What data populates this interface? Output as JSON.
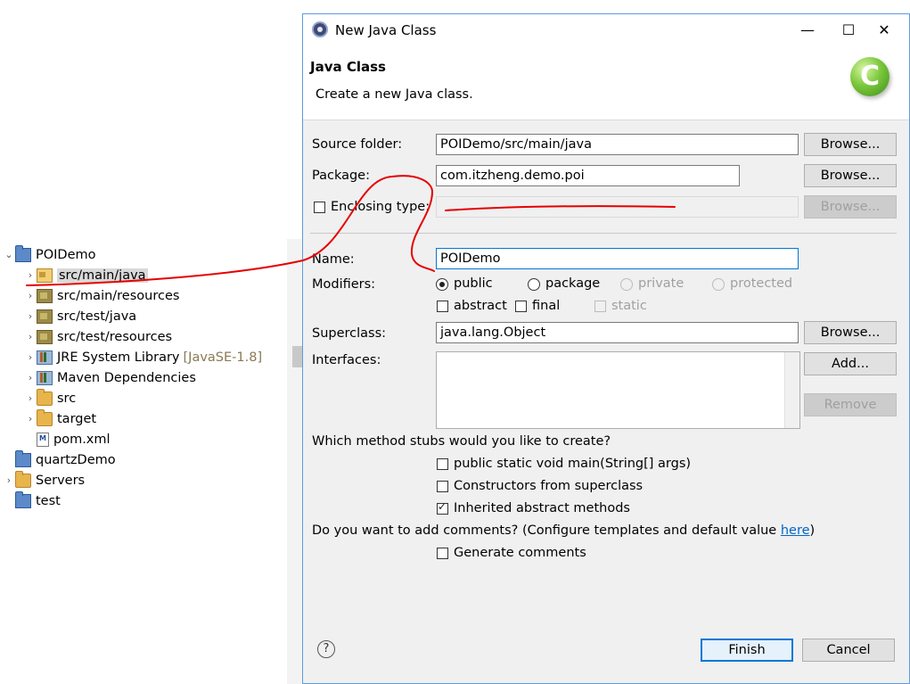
{
  "explorer": {
    "items": [
      {
        "label": "POIDemo",
        "decoration": "",
        "icon": "project-icon",
        "chevron": "v",
        "indent": 0
      },
      {
        "label": "src/main/java",
        "decoration": "",
        "icon": "source-folder-icon",
        "chevron": ">",
        "indent": 1,
        "selected": true
      },
      {
        "label": "src/main/resources",
        "decoration": "",
        "icon": "package-folder-icon",
        "chevron": ">",
        "indent": 1
      },
      {
        "label": "src/test/java",
        "decoration": "",
        "icon": "package-folder-icon",
        "chevron": ">",
        "indent": 1
      },
      {
        "label": "src/test/resources",
        "decoration": "",
        "icon": "package-folder-icon",
        "chevron": ">",
        "indent": 1
      },
      {
        "label": "JRE System Library",
        "decoration": "[JavaSE-1.8]",
        "icon": "library-icon",
        "chevron": ">",
        "indent": 1
      },
      {
        "label": "Maven Dependencies",
        "decoration": "",
        "icon": "library-icon",
        "chevron": ">",
        "indent": 1
      },
      {
        "label": "src",
        "decoration": "",
        "icon": "folder-icon",
        "chevron": ">",
        "indent": 1
      },
      {
        "label": "target",
        "decoration": "",
        "icon": "folder-icon",
        "chevron": ">",
        "indent": 1
      },
      {
        "label": "pom.xml",
        "decoration": "",
        "icon": "pom-file-icon",
        "chevron": "",
        "indent": 1
      },
      {
        "label": "quartzDemo",
        "decoration": "",
        "icon": "project-icon",
        "chevron": "",
        "indent": 0
      },
      {
        "label": "Servers",
        "decoration": "",
        "icon": "folder-icon",
        "chevron": ">",
        "indent": 0
      },
      {
        "label": "test",
        "decoration": "",
        "icon": "project-icon",
        "chevron": "",
        "indent": 0
      }
    ]
  },
  "dialog": {
    "title": "New Java Class",
    "controls": {
      "minimize": "—",
      "maximize": "☐",
      "close": "✕"
    },
    "banner": {
      "title": "Java Class",
      "description": "Create a new Java class.",
      "icon_letter": "C"
    },
    "source_folder": {
      "label": "Source folder:",
      "value": "POIDemo/src/main/java",
      "browse": "Browse..."
    },
    "package": {
      "label": "Package:",
      "value": "com.itzheng.demo.poi",
      "browse": "Browse..."
    },
    "enclosing": {
      "label": "Enclosing type:",
      "value": "",
      "browse": "Browse...",
      "checked": false
    },
    "name": {
      "label": "Name:",
      "value": "POIDemo"
    },
    "modifiers": {
      "label": "Modifiers:",
      "radios": [
        {
          "label": "public",
          "selected": true,
          "enabled": true
        },
        {
          "label": "package",
          "selected": false,
          "enabled": true
        },
        {
          "label": "private",
          "selected": false,
          "enabled": false
        },
        {
          "label": "protected",
          "selected": false,
          "enabled": false
        }
      ],
      "checks": [
        {
          "label": "abstract",
          "checked": false,
          "enabled": true
        },
        {
          "label": "final",
          "checked": false,
          "enabled": true
        },
        {
          "label": "static",
          "checked": false,
          "enabled": false
        }
      ]
    },
    "superclass": {
      "label": "Superclass:",
      "value": "java.lang.Object",
      "browse": "Browse..."
    },
    "interfaces": {
      "label": "Interfaces:",
      "add": "Add...",
      "remove": "Remove"
    },
    "stubs": {
      "question": "Which method stubs would you like to create?",
      "options": [
        {
          "label": "public static void main(String[] args)",
          "checked": false
        },
        {
          "label": "Constructors from superclass",
          "checked": false
        },
        {
          "label": "Inherited abstract methods",
          "checked": true
        }
      ]
    },
    "comments": {
      "question": "Do you want to add comments? (Configure templates and default value ",
      "link": "here",
      "question_end": ")",
      "option": {
        "label": "Generate comments",
        "checked": false
      }
    },
    "footer": {
      "help": "?",
      "finish": "Finish",
      "cancel": "Cancel"
    }
  },
  "colors": {
    "accent": "#0078d7",
    "annotation": "#e60000",
    "dialog_border": "#5c9dde"
  }
}
